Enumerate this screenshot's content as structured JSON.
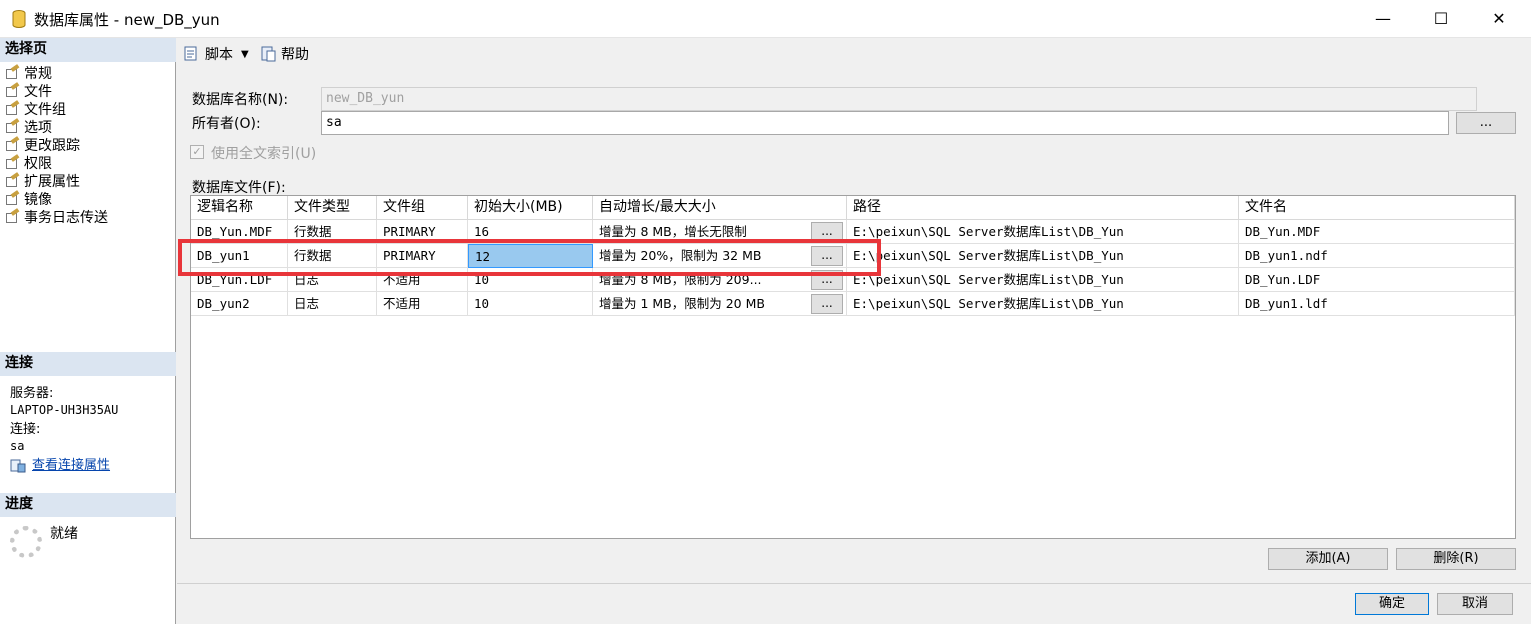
{
  "window": {
    "title": "数据库属性 - new_DB_yun",
    "minimize_glyph": "—",
    "maximize_glyph": "☐",
    "close_glyph": "✕"
  },
  "left": {
    "select_page_header": "选择页",
    "nav_items": [
      {
        "label": "常规",
        "icon": "page-wrench-icon"
      },
      {
        "label": "文件",
        "icon": "page-wrench-icon",
        "selected": true
      },
      {
        "label": "文件组",
        "icon": "page-wrench-icon"
      },
      {
        "label": "选项",
        "icon": "page-wrench-icon"
      },
      {
        "label": "更改跟踪",
        "icon": "page-wrench-icon"
      },
      {
        "label": "权限",
        "icon": "page-wrench-icon"
      },
      {
        "label": "扩展属性",
        "icon": "page-wrench-icon"
      },
      {
        "label": "镜像",
        "icon": "page-wrench-icon"
      },
      {
        "label": "事务日志传送",
        "icon": "page-wrench-icon"
      }
    ],
    "connection_header": "连接",
    "server_label": "服务器:",
    "server_value": "LAPTOP-UH3H35AU",
    "connection_label": "连接:",
    "connection_value": "sa",
    "view_connection_link": "查看连接属性",
    "progress_header": "进度",
    "progress_status": "就绪"
  },
  "toolbar": {
    "script_label": "脚本",
    "help_label": "帮助"
  },
  "form": {
    "db_name_label": "数据库名称(N):",
    "db_name_value": "new_DB_yun",
    "owner_label": "所有者(O):",
    "owner_value": "sa",
    "browse_button": "...",
    "fulltext_label": "使用全文索引(U)",
    "fulltext_checked": true,
    "db_files_label": "数据库文件(F):"
  },
  "grid": {
    "columns": [
      "逻辑名称",
      "文件类型",
      "文件组",
      "初始大小(MB)",
      "自动增长/最大大小",
      "路径",
      "文件名"
    ],
    "rows": [
      {
        "logical": "DB_Yun.MDF",
        "type": "行数据",
        "group": "PRIMARY",
        "size": "16",
        "growth": "增量为 8 MB，增长无限制",
        "path": "E:\\peixun\\SQL Server数据库List\\DB_Yun",
        "file": "DB_Yun.MDF"
      },
      {
        "logical": "DB_yun1",
        "type": "行数据",
        "group": "PRIMARY",
        "size": "12",
        "growth": "增量为 20%，限制为 32 MB",
        "path": "E:\\peixun\\SQL Server数据库List\\DB_Yun",
        "file": "DB_yun1.ndf"
      },
      {
        "logical": "DB_Yun.LDF",
        "type": "日志",
        "group": "不适用",
        "size": "10",
        "growth": "增量为 8 MB，限制为 209...",
        "path": "E:\\peixun\\SQL Server数据库List\\DB_Yun",
        "file": "DB_Yun.LDF"
      },
      {
        "logical": "DB_yun2",
        "type": "日志",
        "group": "不适用",
        "size": "10",
        "growth": "增量为 1 MB，限制为 20 MB",
        "path": "E:\\peixun\\SQL Server数据库List\\DB_Yun",
        "file": "DB_yun1.ldf"
      }
    ],
    "ellipsis": "..."
  },
  "buttons": {
    "add": "添加(A)",
    "remove": "删除(R)",
    "ok": "确定",
    "cancel": "取消"
  },
  "colors": {
    "highlight_border": "#e8353a",
    "edit_cell_bg": "#99c9ef",
    "pane_header_bg": "#dbe5f1"
  }
}
